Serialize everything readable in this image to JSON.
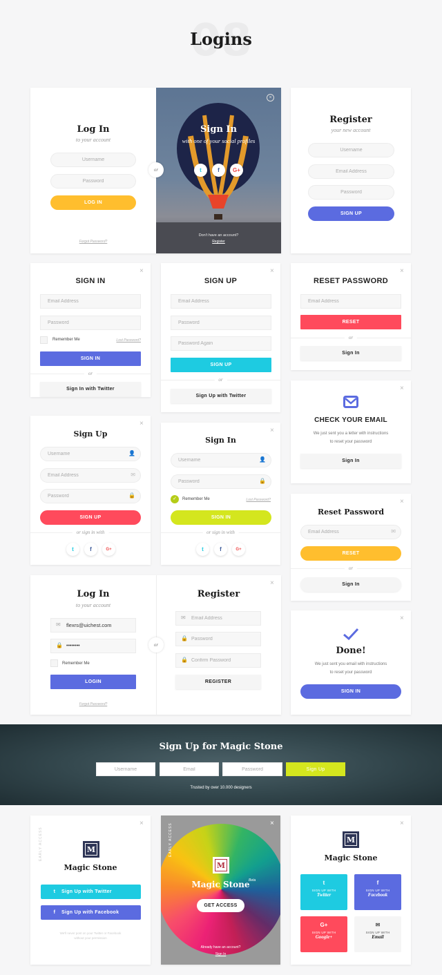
{
  "page": {
    "number": "08",
    "title": "Logins"
  },
  "colors": {
    "yellow": "#FFBE2E",
    "purple": "#5B6BE0",
    "cyan": "#1ECBE1",
    "red": "#FF4A5C",
    "lime": "#D4E61E",
    "navy": "#2E3556"
  },
  "login_split": {
    "title": "Log In",
    "subtitle": "to your account",
    "username": "Username",
    "password": "Password",
    "button": "LOG IN",
    "forgot": "Forgot Password?",
    "or": "or",
    "social": {
      "title": "Sign In",
      "subtitle": "with one of your social profiles",
      "no_account": "Don't have an account?",
      "register": "Register",
      "icons": [
        "twitter-icon",
        "facebook-icon",
        "google-plus-icon"
      ]
    }
  },
  "register1": {
    "title": "Register",
    "subtitle": "your new account",
    "username": "Username",
    "email": "Email Address",
    "password": "Password",
    "button": "SIGN UP"
  },
  "signin1": {
    "title": "SIGN IN",
    "email": "Email Address",
    "password": "Password",
    "remember": "Remember Me",
    "lost": "Lost Password?",
    "button": "SIGN IN",
    "or": "or",
    "twitter": "Sign In with Twitter"
  },
  "signup1": {
    "title": "SIGN UP",
    "email": "Email Address",
    "password": "Password",
    "password_again": "Password Again",
    "button": "SIGN UP",
    "or": "or",
    "twitter": "Sign Up with Twitter"
  },
  "reset1": {
    "title": "RESET PASSWORD",
    "email": "Email Address",
    "button": "RESET",
    "or": "or",
    "signin": "Sign In"
  },
  "check_email": {
    "title": "CHECK YOUR EMAIL",
    "text1": "We just sent you a letter with instructions",
    "text2": "to reset your password",
    "button": "Sign In"
  },
  "signup2": {
    "title": "Sign Up",
    "username": "Username",
    "email": "Email Address",
    "password": "Password",
    "button": "SIGN UP",
    "or": "or sign in with"
  },
  "signin2": {
    "title": "Sign In",
    "username": "Username",
    "password": "Password",
    "remember": "Remember Me",
    "lost": "Lost Password?",
    "button": "SIGN IN",
    "or": "or sign in with"
  },
  "reset2": {
    "title": "Reset Password",
    "email": "Email Address",
    "button": "RESET",
    "or": "or",
    "signin": "Sign In"
  },
  "login_register": {
    "login_title": "Log In",
    "login_subtitle": "to your account",
    "email_value": "flexrs@uichest.com",
    "password_value": "••••••••",
    "remember": "Remember Me",
    "login_button": "LOGIN",
    "forgot": "Forgot Password?",
    "or": "or",
    "register_title": "Register",
    "reg_email": "Email Address",
    "reg_password": "Password",
    "reg_confirm": "Confirm Password",
    "register_button": "REGISTER"
  },
  "done": {
    "title": "Done!",
    "text1": "We just sent you email with instructions",
    "text2": "to reset your password",
    "button": "SIGN IN"
  },
  "banner": {
    "title": "Sign Up for Magic Stone",
    "username": "Username",
    "email": "Email",
    "password": "Password",
    "button": "Sign Up",
    "trusted": "Trusted by over 10.000 designers"
  },
  "magic1": {
    "tag": "EARLY ACCESS",
    "logo": "M",
    "title": "Magic Stone",
    "twitter": "Sign Up with Twitter",
    "facebook": "Sign Up with Facebook",
    "note1": "We'll never post on your Twitter or Facebook",
    "note2": "without your permission"
  },
  "magic2": {
    "tag": "EARLY ACCESS",
    "logo": "M",
    "title": "Magic Stone",
    "beta": "Beta",
    "button": "GET ACCESS",
    "have_account": "Already have an account?",
    "signin": "Sign In"
  },
  "magic3": {
    "logo": "M",
    "title": "Magic Stone",
    "tiles": [
      {
        "icon": "twitter-icon",
        "label": "SIGN UP WITH",
        "name": "Twitter"
      },
      {
        "icon": "facebook-icon",
        "label": "SIGN UP WITH",
        "name": "Facebook"
      },
      {
        "icon": "google-plus-icon",
        "label": "SIGN UP WITH",
        "name": "Google+"
      },
      {
        "icon": "email-icon",
        "label": "SIGN UP WITH",
        "name": "Email"
      }
    ]
  }
}
